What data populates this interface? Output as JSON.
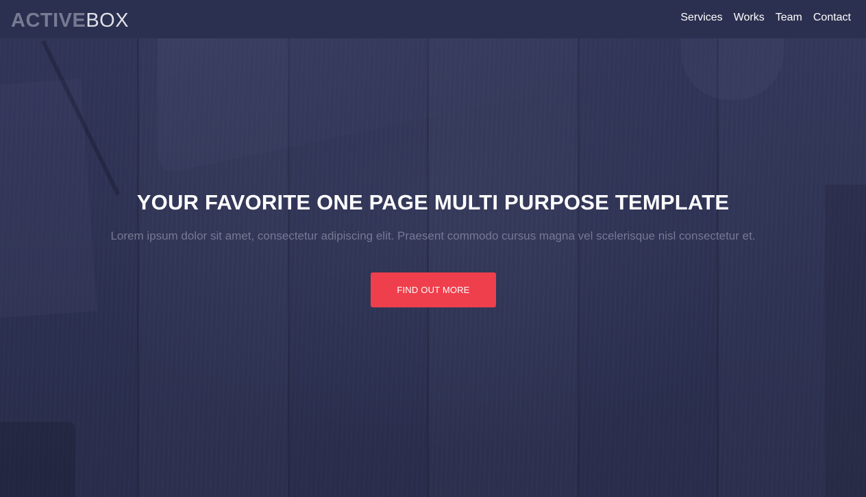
{
  "brand": {
    "bold": "ACTIVE",
    "light": "BOX"
  },
  "nav": {
    "items": [
      {
        "label": "Services"
      },
      {
        "label": "Works"
      },
      {
        "label": "Team"
      },
      {
        "label": "Contact"
      }
    ]
  },
  "hero": {
    "title": "YOUR FAVORITE ONE PAGE MULTI PURPOSE TEMPLATE",
    "subtitle": "Lorem ipsum dolor sit amet, consectetur adipiscing elit. Praesent commodo cursus magna vel scelerisque nisl consectetur et.",
    "cta_label": "FIND OUT MORE"
  },
  "colors": {
    "navbar_bg": "#2c3050",
    "hero_bg": "#2d3152",
    "accent": "#ef3f4c",
    "brand_bold": "#777b92",
    "subtitle": "#767a93"
  }
}
